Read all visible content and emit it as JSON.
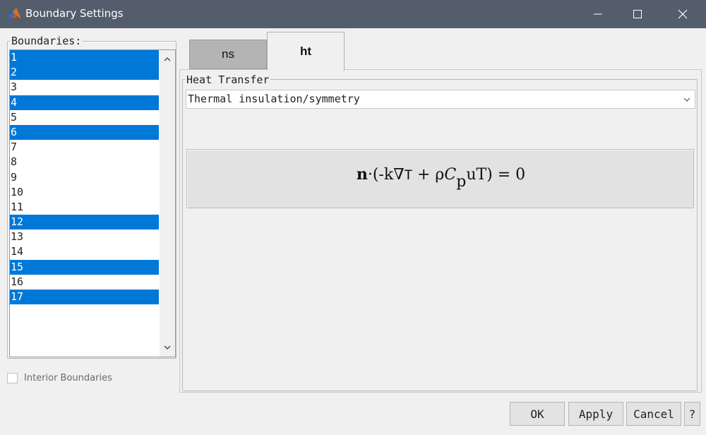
{
  "window": {
    "title": "Boundary Settings",
    "titlebar_color": "#535d6b"
  },
  "boundaries": {
    "legend": "Boundaries:",
    "items": [
      {
        "label": "1",
        "selected": true
      },
      {
        "label": "2",
        "selected": true
      },
      {
        "label": "3",
        "selected": false
      },
      {
        "label": "4",
        "selected": true
      },
      {
        "label": "5",
        "selected": false
      },
      {
        "label": "6",
        "selected": true
      },
      {
        "label": "7",
        "selected": false
      },
      {
        "label": "8",
        "selected": false
      },
      {
        "label": "9",
        "selected": false
      },
      {
        "label": "10",
        "selected": false
      },
      {
        "label": "11",
        "selected": false
      },
      {
        "label": "12",
        "selected": true
      },
      {
        "label": "13",
        "selected": false
      },
      {
        "label": "14",
        "selected": false
      },
      {
        "label": "15",
        "selected": true
      },
      {
        "label": "16",
        "selected": false
      },
      {
        "label": "17",
        "selected": true
      }
    ],
    "selection_color": "#0078d7",
    "interior_label": "Interior Boundaries",
    "interior_checked": false
  },
  "tabs": [
    {
      "label": "ns",
      "active": false
    },
    {
      "label": "ht",
      "active": true
    }
  ],
  "heat_transfer": {
    "legend": "Heat Transfer",
    "condition": "Thermal insulation/symmetry",
    "equation": {
      "n": "n",
      "dot": "·",
      "open": "(-k",
      "nabla": "∇",
      "T1": "T",
      "plus": " + ρ",
      "C": "C",
      "p": "p",
      "uT": "uT",
      "close": ") = 0"
    }
  },
  "buttons": {
    "ok": "OK",
    "apply": "Apply",
    "cancel": "Cancel",
    "help": "?"
  }
}
